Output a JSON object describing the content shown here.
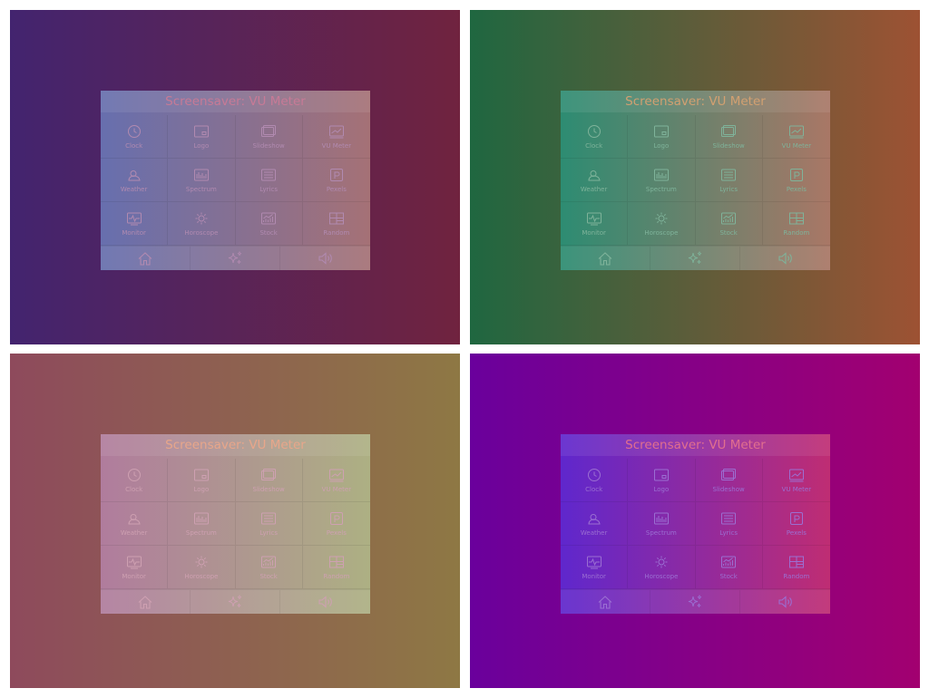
{
  "title": "Screensaver: VU Meter",
  "tiles": [
    {
      "label": "Clock",
      "icon": "clock-icon"
    },
    {
      "label": "Logo",
      "icon": "logo-icon"
    },
    {
      "label": "Slideshow",
      "icon": "slideshow-icon"
    },
    {
      "label": "VU Meter",
      "icon": "vu-meter-icon"
    },
    {
      "label": "Weather",
      "icon": "weather-icon"
    },
    {
      "label": "Spectrum",
      "icon": "spectrum-icon"
    },
    {
      "label": "Lyrics",
      "icon": "lyrics-icon"
    },
    {
      "label": "Pexels",
      "icon": "pexels-icon"
    },
    {
      "label": "Monitor",
      "icon": "monitor-icon"
    },
    {
      "label": "Horoscope",
      "icon": "horoscope-icon"
    },
    {
      "label": "Stock",
      "icon": "stock-icon"
    },
    {
      "label": "Random",
      "icon": "random-icon"
    }
  ],
  "bottom_bar": [
    "home-icon",
    "sparkle-icon",
    "speaker-icon"
  ],
  "themes": [
    {
      "bg_left": "#43246f",
      "bg_right": "#70233f",
      "panel_left": "#676fae",
      "panel_right": "#a57176",
      "text": "#c77a96",
      "icon": "#b18ab0"
    },
    {
      "bg_left": "#1f6740",
      "bg_right": "#9d5233",
      "panel_left": "#2d8c72",
      "panel_right": "#a97766",
      "text": "#d2a071",
      "icon": "#7fb39a"
    },
    {
      "bg_left": "#8e4a5c",
      "bg_right": "#8e7844",
      "panel_left": "#b07c9d",
      "panel_right": "#adb083",
      "text": "#e8a68a",
      "icon": "#cea0b1"
    },
    {
      "bg_left": "#6a009c",
      "bg_right": "#a20070",
      "panel_left": "#5f27cd",
      "panel_right": "#bf2d73",
      "text": "#e16f8e",
      "icon": "#9b6fd2"
    }
  ]
}
